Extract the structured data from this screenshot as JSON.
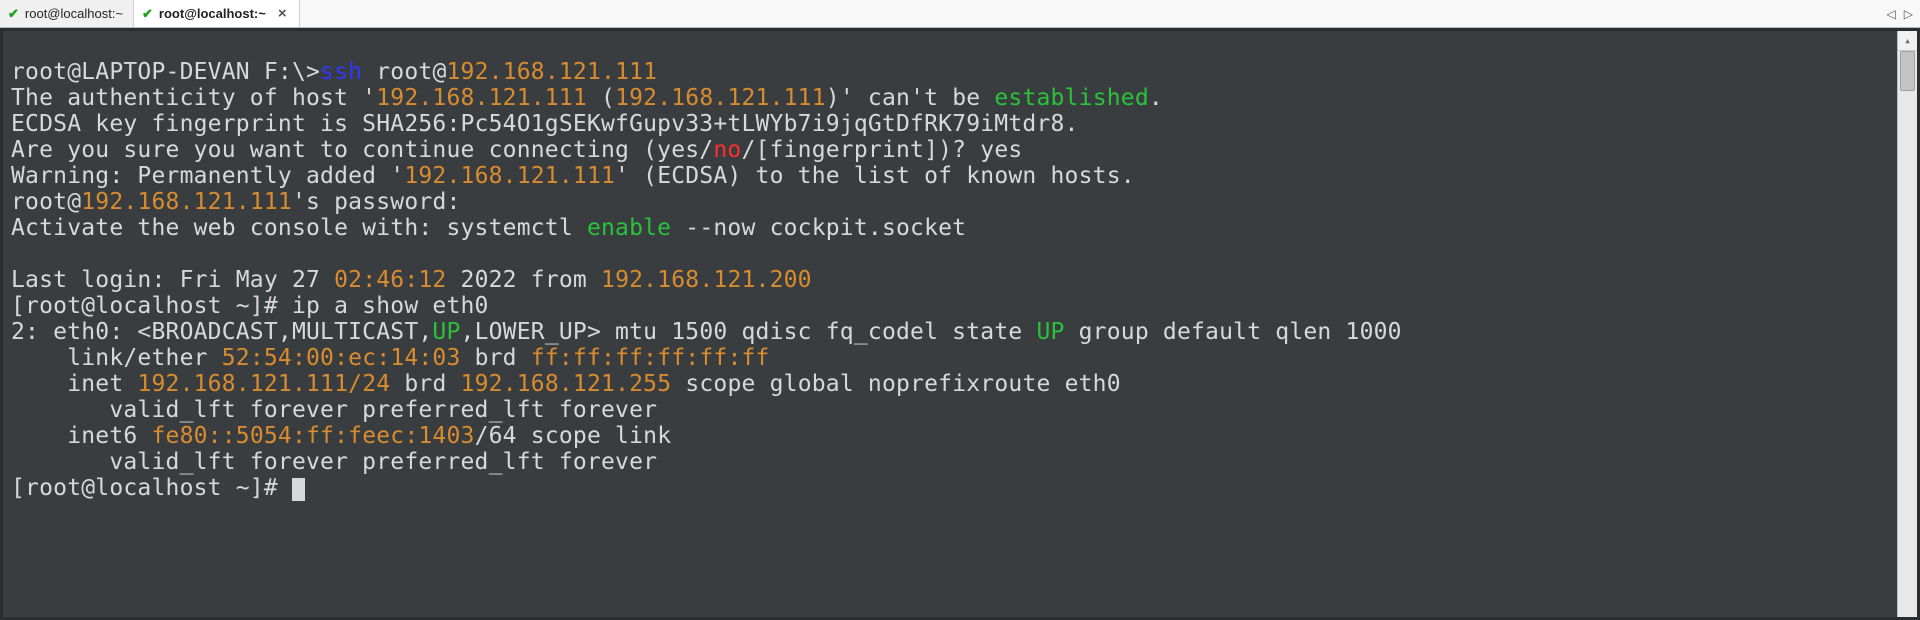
{
  "tabs": [
    {
      "label": "root@localhost:~",
      "active": false,
      "closable": false
    },
    {
      "label": "root@localhost:~",
      "active": true,
      "closable": true
    }
  ],
  "prompt1": {
    "userhost": "root@LAPTOP-DEVAN F:\\>",
    "cmd": "ssh",
    "arg_prefix": " root@",
    "arg_ip": "192.168.121.111"
  },
  "auth": {
    "l1a": "The authenticity of host '",
    "l1b": "192.168.121.111",
    "l1c": " (",
    "l1d": "192.168.121.111",
    "l1e": ")' can't be ",
    "l1f": "established",
    "l1g": "."
  },
  "fingerprint": "ECDSA key fingerprint is SHA256:Pc54O1gSEKwfGupv33+tLWYb7i9jqGtDfRK79iMtdr8.",
  "confirm": {
    "a": "Are you sure you want to continue connecting (yes/",
    "b": "no",
    "c": "/[fingerprint])? yes"
  },
  "warning": {
    "a": "Warning: Permanently added '",
    "b": "192.168.121.111",
    "c": "' (ECDSA) to the list of known hosts."
  },
  "pwd": {
    "a": "root@",
    "b": "192.168.121.111",
    "c": "'s password:"
  },
  "activate": {
    "a": "Activate the web console with: systemctl ",
    "b": "enable",
    "c": " --now cockpit.socket"
  },
  "lastlogin": {
    "a": "Last login: Fri May 27 ",
    "b": "02:46:12",
    "c": " 2022 from ",
    "d": "192.168.121.200"
  },
  "prompt2": "[root@localhost ~]# ip a show eth0",
  "iface": {
    "a": "2: eth0: <BROADCAST,MULTICAST,",
    "b": "UP",
    "c": ",LOWER_UP> mtu 1500 qdisc fq_codel state ",
    "d": "UP",
    "e": " group default qlen 1000"
  },
  "link": {
    "a": "    link/ether ",
    "b": "52:54:00:ec:14:03",
    "c": " brd ",
    "d": "ff:ff:ff:ff:ff:ff"
  },
  "inet": {
    "a": "    inet ",
    "b": "192.168.121.111/24",
    "c": " brd ",
    "d": "192.168.121.255",
    "e": " scope global noprefixroute eth0"
  },
  "valid1": "       valid_lft forever preferred_lft forever",
  "inet6": {
    "a": "    inet6 ",
    "b": "fe80::5054:ff:feec:1403",
    "c": "/64 scope link"
  },
  "valid2": "       valid_lft forever preferred_lft forever",
  "prompt3": "[root@localhost ~]# "
}
